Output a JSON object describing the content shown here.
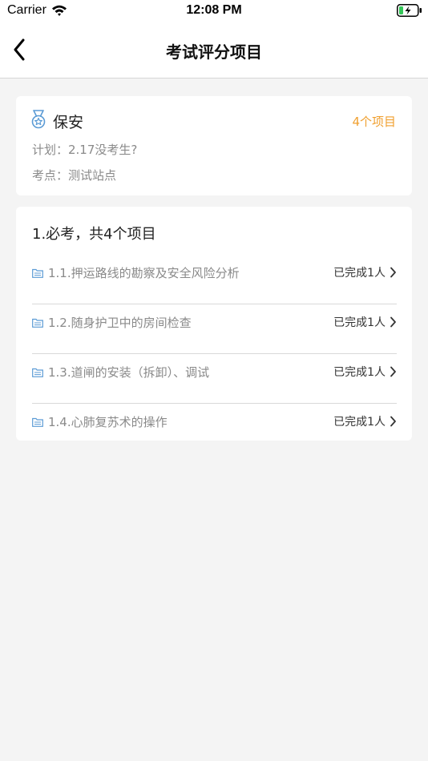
{
  "status_bar": {
    "carrier": "Carrier",
    "time": "12:08 PM"
  },
  "nav": {
    "title": "考试评分项目",
    "back_icon": "chevron-left-icon"
  },
  "summary": {
    "icon": "medal-icon",
    "job_title": "保安",
    "project_count": "4个项目",
    "plan": "计划：2.17没考生?",
    "site": "考点：测试站点"
  },
  "section": {
    "heading": "1.必考，共4个项目",
    "items": [
      {
        "label": "1.1.押运路线的勘察及安全风险分析",
        "status": "已完成1人"
      },
      {
        "label": "1.2.随身护卫中的房间检查",
        "status": "已完成1人"
      },
      {
        "label": "1.3.道闸的安装（拆卸）、调试",
        "status": "已完成1人"
      },
      {
        "label": "1.4.心肺复苏术的操作",
        "status": "已完成1人"
      }
    ]
  },
  "colors": {
    "accent_orange": "#f0a030",
    "icon_blue": "#5b9bd5",
    "muted_text": "#8a8a8a",
    "background": "#f4f4f4"
  }
}
